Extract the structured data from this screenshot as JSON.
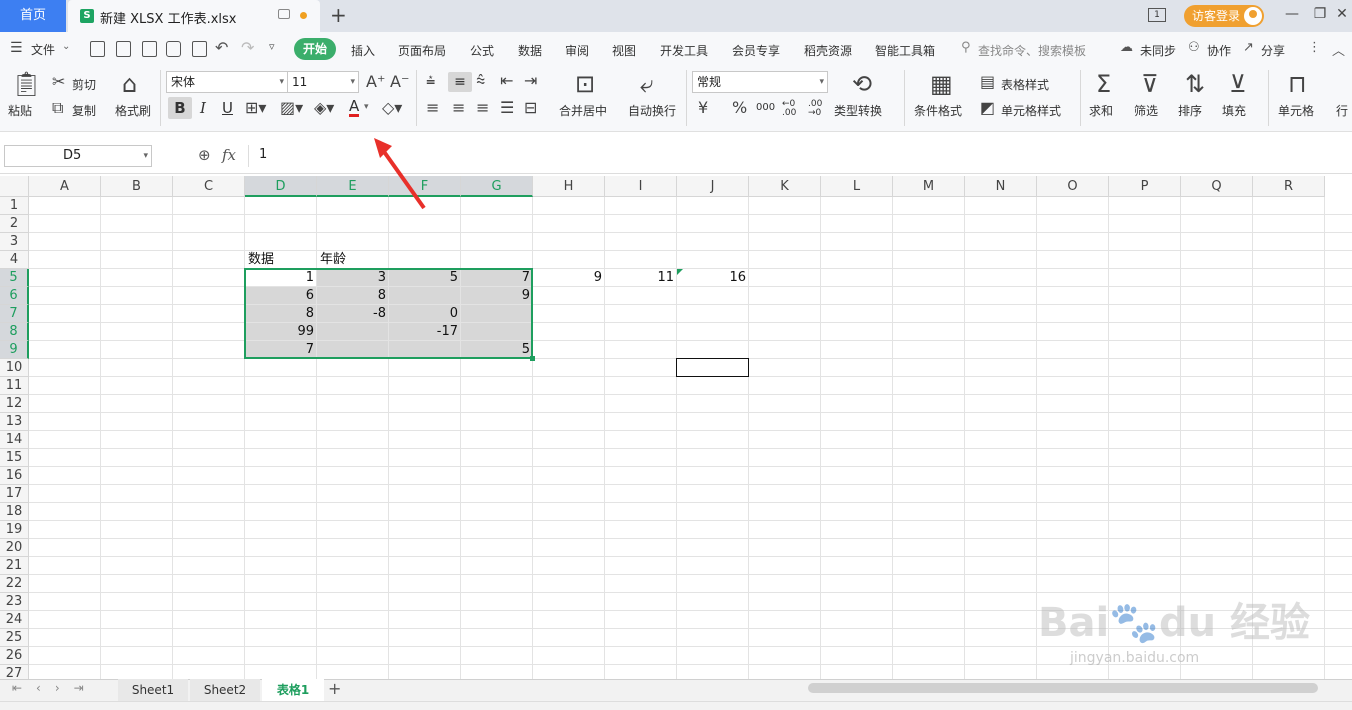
{
  "titlebar": {
    "home_tab": "首页",
    "file_title": "新建 XLSX 工作表.xlsx",
    "new_tab": "+",
    "window_icon_label": "1",
    "login_label": "访客登录"
  },
  "menu": {
    "file_label": "文件",
    "tabs": [
      "开始",
      "插入",
      "页面布局",
      "公式",
      "数据",
      "审阅",
      "视图",
      "开发工具",
      "会员专享",
      "稻壳资源",
      "智能工具箱"
    ],
    "search_label": "查找命令、搜索模板",
    "sync_label": "未同步",
    "collab_label": "协作",
    "share_label": "分享"
  },
  "ribbon": {
    "paste": "粘贴",
    "cut": "剪切",
    "copy": "复制",
    "format_painter": "格式刷",
    "font_name": "宋体",
    "font_size": "11",
    "bold": "B",
    "italic": "I",
    "underline": "U",
    "font_color": "A",
    "merge_center": "合并居中",
    "wrap_text": "自动换行",
    "number_format": "常规",
    "type_convert": "类型转换",
    "cond_format": "条件格式",
    "table_style": "表格样式",
    "cell_style": "单元格样式",
    "sum": "求和",
    "filter": "筛选",
    "sort": "排序",
    "fill": "填充",
    "cell": "单元格",
    "row_col": "行",
    "currency": "¥",
    "percent": "%",
    "thousands": "000"
  },
  "formula_bar": {
    "name_box": "D5",
    "fx": "fx",
    "value": "1"
  },
  "sheet": {
    "columns": [
      "A",
      "B",
      "C",
      "D",
      "E",
      "F",
      "G",
      "H",
      "I",
      "J",
      "K",
      "L",
      "M",
      "N",
      "O",
      "P",
      "Q",
      "R"
    ],
    "rows": [
      "1",
      "2",
      "3",
      "4",
      "5",
      "6",
      "7",
      "8",
      "9",
      "10",
      "11",
      "12",
      "13",
      "14",
      "15",
      "16",
      "17",
      "18",
      "19",
      "20",
      "21",
      "22",
      "23",
      "24",
      "25",
      "26",
      "27"
    ],
    "header_row": {
      "D4": "数据",
      "E4": "年龄"
    },
    "cells": {
      "D5": "1",
      "E5": "3",
      "F5": "5",
      "G5": "7",
      "H5": "9",
      "I5": "11",
      "J5": "16",
      "D6": "6",
      "E6": "8",
      "G6": "9",
      "D7": "8",
      "E7": "-8",
      "F7": "0",
      "D8": "99",
      "F8": "-17",
      "D9": "7",
      "G9": "5"
    }
  },
  "sheet_tabs": [
    "Sheet1",
    "Sheet2",
    "表格1"
  ],
  "active_sheet": "表格1",
  "watermark": "Baidu 经验 jingyan.baidu.com",
  "colors": {
    "accent_green": "#1e9e5e",
    "home_blue": "#3d7ff2",
    "login_orange": "#f0a030",
    "arrow_red": "#e8302a"
  }
}
